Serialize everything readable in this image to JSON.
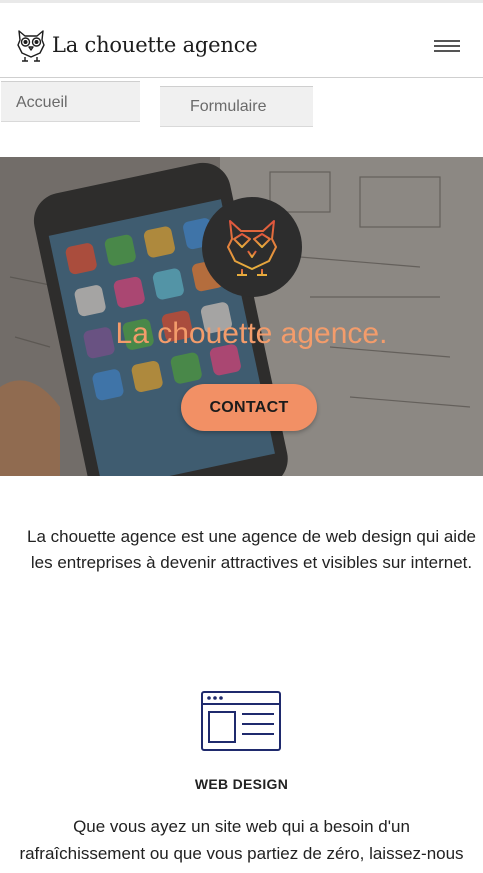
{
  "header": {
    "brand_name": "La chouette agence",
    "logo_icon": "owl-icon",
    "menu_icon": "hamburger-menu-icon"
  },
  "nav": {
    "items": [
      {
        "label": "Accueil"
      },
      {
        "label": "Formulaire"
      }
    ]
  },
  "hero": {
    "title": "La chouette agence.",
    "logo_icon": "owl-icon",
    "cta_label": "CONTACT",
    "background": "phone-on-desk-photo"
  },
  "intro": {
    "line1": "La chouette agence est une agence de web design qui aide",
    "line2": "les entreprises à devenir attractives et visibles sur internet."
  },
  "services": [
    {
      "icon": "web-design-window-icon",
      "title": "WEB DESIGN",
      "text": "Que vous ayez un site web qui a besoin d'un rafraîchissement ou que vous partiez de zéro, laissez-nous vous aider à concevoir le site qu'il vous faut."
    }
  ],
  "colors": {
    "accent": "#f29065",
    "hero_title": "#f39c6b",
    "logo_circle": "#2d2d2d",
    "icon_navy": "#1f2a6d"
  }
}
